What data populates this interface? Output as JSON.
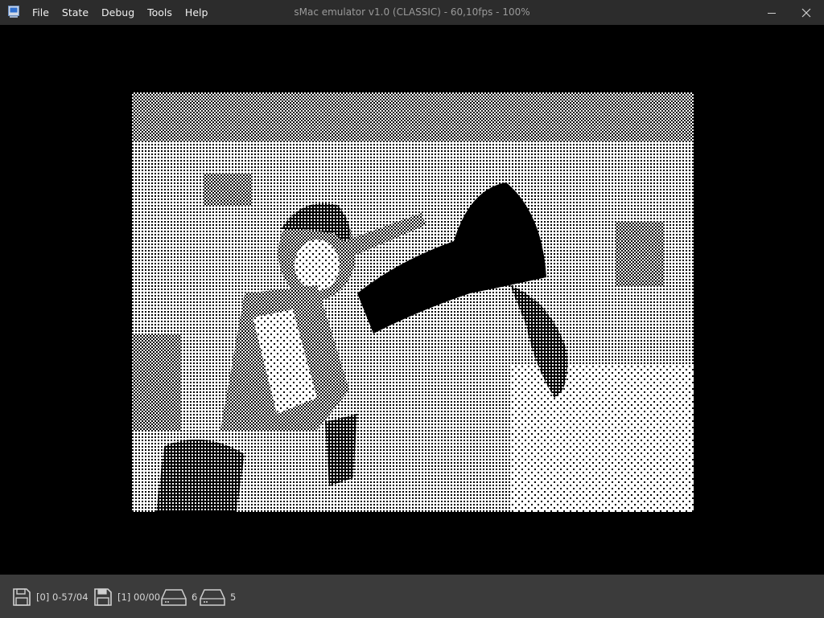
{
  "window": {
    "title": "sMac emulator v1.0 (CLASSIC) - 60,10fps - 100%",
    "icon": "mac-app-icon",
    "controls": [
      "minimize-icon",
      "close-icon"
    ]
  },
  "menu": [
    {
      "label": "File"
    },
    {
      "label": "State"
    },
    {
      "label": "Debug"
    },
    {
      "label": "Tools"
    },
    {
      "label": "Help"
    }
  ],
  "screen": {
    "description_icon": "dithered-photo",
    "colors": {
      "background": "#000000",
      "paper": "#ffffff",
      "ink": "#000000"
    }
  },
  "status": {
    "floppy0": {
      "icon": "floppy-disk-icon",
      "label": "[0] 0-57/04"
    },
    "floppy1": {
      "icon": "floppy-disk-icon",
      "label": "[1] 00/00"
    },
    "hdd0": {
      "icon": "hard-drive-icon",
      "label": "6"
    },
    "hdd1": {
      "icon": "hard-drive-icon",
      "label": "5"
    }
  },
  "colors": {
    "titlebar": "#2c2c2c",
    "statusbar": "#3b3b3b",
    "text": "#e6e6e6",
    "title_text": "#9a9a9a"
  }
}
